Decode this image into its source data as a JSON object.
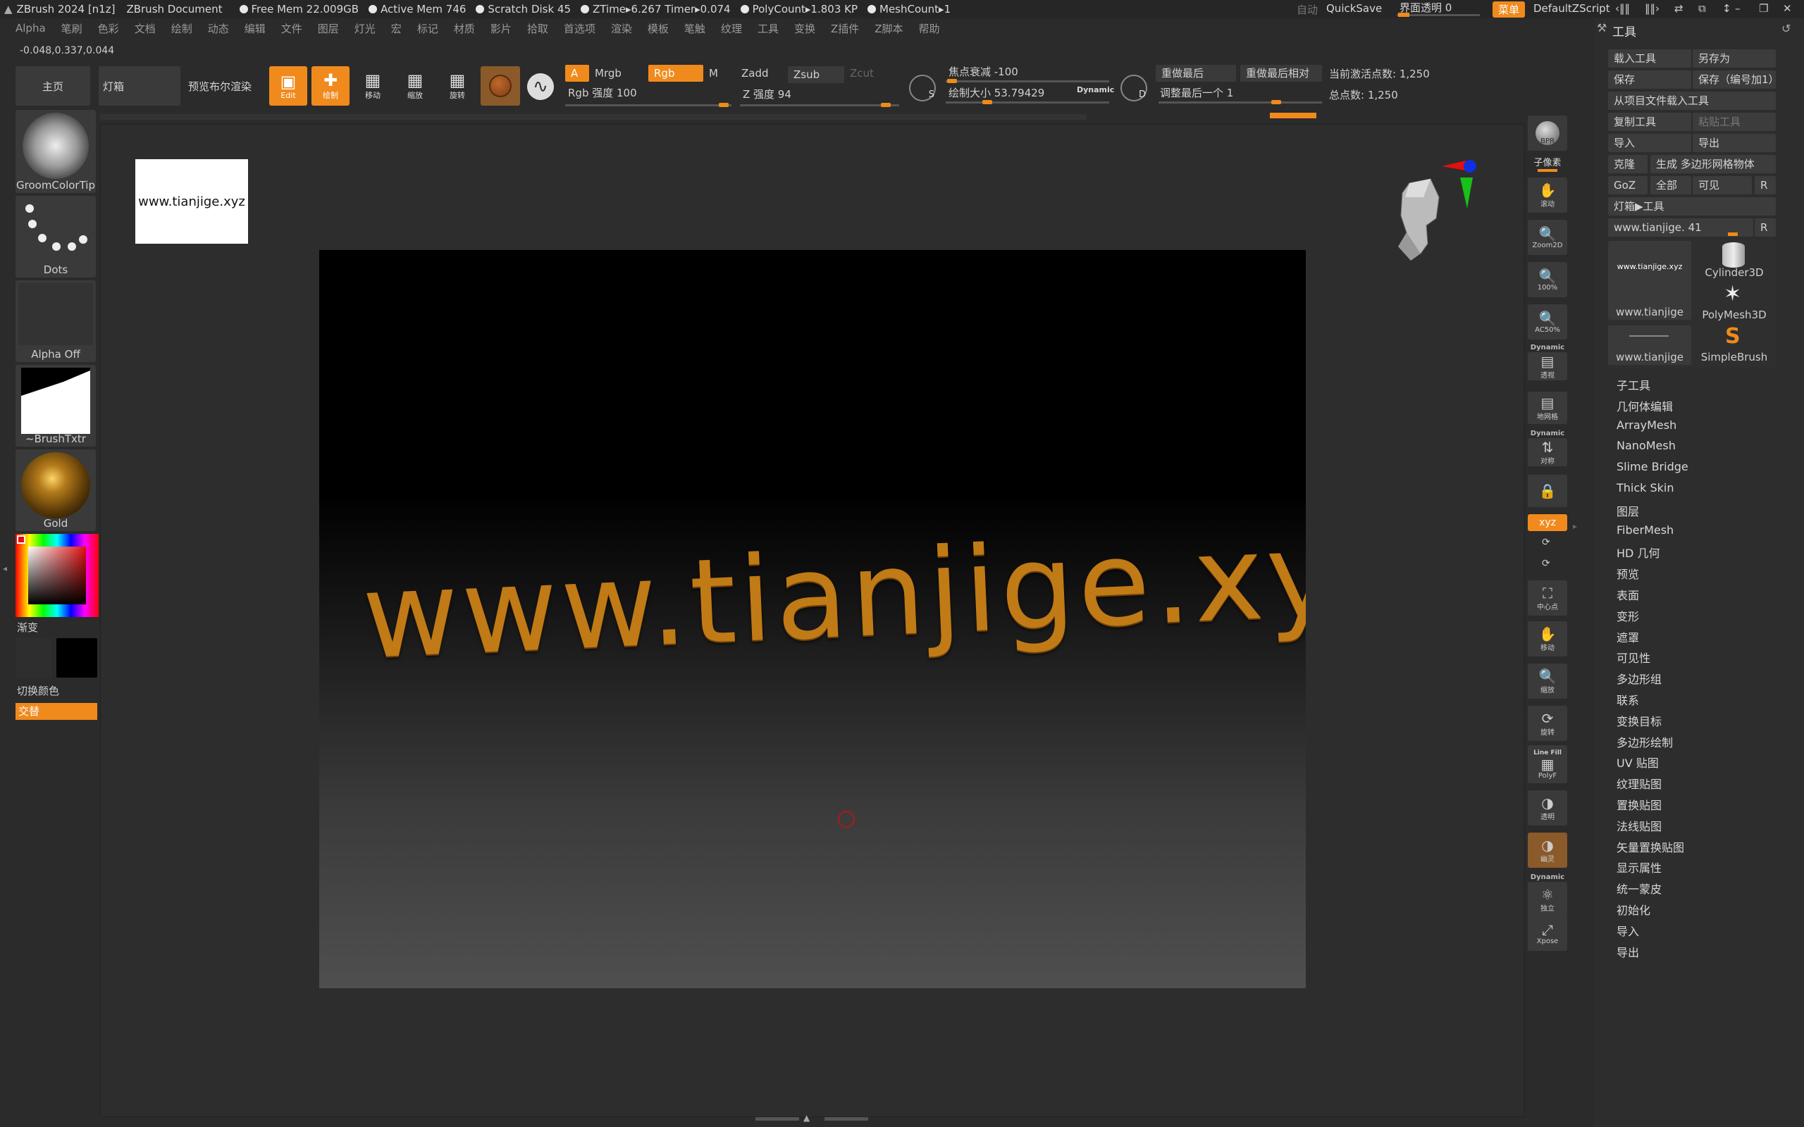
{
  "titlebar": {
    "app_title": "ZBrush 2024 [n1z]",
    "doc_title": "ZBrush Document",
    "free_mem": "Free Mem 22.009GB",
    "active_mem": "Active Mem 746",
    "scratch_disk": "Scratch Disk 45",
    "ztime": "ZTime▸6.267 Timer▸0.074",
    "polycount": "PolyCount▸1.803 KP",
    "meshcount": "MeshCount▸1",
    "auto": "自动",
    "quicksave": "QuickSave",
    "ui_transparency": "界面透明 0",
    "menu_btn": "菜单",
    "script": "DefaultZScript"
  },
  "menubar": [
    "Alpha",
    "笔刷",
    "色彩",
    "文档",
    "绘制",
    "动态",
    "编辑",
    "文件",
    "图层",
    "灯光",
    "宏",
    "标记",
    "材质",
    "影片",
    "拾取",
    "首选项",
    "渲染",
    "模板",
    "笔触",
    "纹理",
    "工具",
    "变换",
    "Z插件",
    "Z脚本",
    "帮助"
  ],
  "coords": "-0.048,0.337,0.044",
  "shelf": {
    "home": "主页",
    "lightbox": "灯箱",
    "bpr": "预览布尔渲染",
    "edit": "Edit",
    "draw": "绘制",
    "move": "移动",
    "scale": "缩放",
    "rotate": "旋转"
  },
  "brush_settings": {
    "a": "A",
    "mrgb": "Mrgb",
    "rgb": "Rgb",
    "m": "M",
    "rgb_intensity": "Rgb 强度 100",
    "zadd": "Zadd",
    "zsub": "Zsub",
    "zcut": "Zcut",
    "z_intensity": "Z 强度 94",
    "s_label": "S",
    "focal_shift": "焦点衰减 -100",
    "draw_size": "绘制大小 53.79429",
    "dynamic": "Dynamic",
    "d_label": "D",
    "replay_last": "重做最后",
    "replay_last_rel": "重做最后相对",
    "adjust_last": "调整最后一个 1",
    "active_points": "当前激活点数: 1,250",
    "total_points": "总点数: 1,250"
  },
  "left_shelf": {
    "brush": "GroomColorTip",
    "stroke": "Dots",
    "alpha": "Alpha Off",
    "texture": "~BrushTxtr",
    "material": "Gold",
    "gradient": "渐变",
    "switch_color": "切换颜色",
    "alternate": "交替"
  },
  "canvas": {
    "thumbnail_text": "www.tianjige.xyz",
    "model_text": "www.tianjige.xyz"
  },
  "right_toolbar": {
    "bpr": "BPR",
    "subpixel": "子像素",
    "scroll": "滚动",
    "zoom2d": "Zoom2D",
    "zoom100": "100%",
    "ac50": "AC50%",
    "dynamic1": "Dynamic",
    "persp": "透视",
    "floor": "地网格",
    "dynamic2": "Dynamic",
    "symmetry": "对称",
    "xyz": "xyz",
    "center": "中心点",
    "move": "移动",
    "scale": "缩放",
    "rotate": "旋转",
    "linefill": "Line Fill",
    "polyf": "PolyF",
    "transp": "透明",
    "ghost": "幽灵",
    "dynamic3": "Dynamic",
    "solo": "独立",
    "xpose": "Xpose"
  },
  "tool_panel": {
    "title": "工具",
    "load_tool": "载入工具",
    "save_as": "另存为",
    "save": "保存",
    "save_inc": "保存（编号加1）",
    "load_from_project": "从项目文件载入工具",
    "copy_tool": "复制工具",
    "paste_tool": "粘贴工具",
    "import": "导入",
    "export": "导出",
    "clone": "克隆",
    "make_polymesh": "生成 多边形网格物体",
    "goz": "GoZ",
    "all": "全部",
    "visible": "可见",
    "r": "R",
    "lightbox_tools": "灯箱▶工具",
    "current_tool": "www.tianjige. 41",
    "thumbs": [
      {
        "label": "www.tianjige",
        "preview": "www.tianjige.xyz"
      },
      {
        "label": "Cylinder3D"
      },
      {
        "label": "PolyMesh3D"
      },
      {
        "label": "www.tianjige"
      },
      {
        "label": "SimpleBrush"
      }
    ],
    "subpalettes": [
      "子工具",
      "几何体编辑",
      "ArrayMesh",
      "NanoMesh",
      "Slime Bridge",
      "Thick Skin",
      "图层",
      "FiberMesh",
      "HD 几何",
      "预览",
      "表面",
      "变形",
      "遮罩",
      "可见性",
      "多边形组",
      "联系",
      "变换目标",
      "多边形绘制",
      "UV 贴图",
      "纹理贴图",
      "置换贴图",
      "法线贴图",
      "矢量置换贴图",
      "显示属性",
      "统一蒙皮",
      "初始化",
      "导入",
      "导出"
    ]
  },
  "colors": {
    "accent": "#f08a1c",
    "background": "#2b2b2b",
    "model_text": "#c07a16"
  }
}
